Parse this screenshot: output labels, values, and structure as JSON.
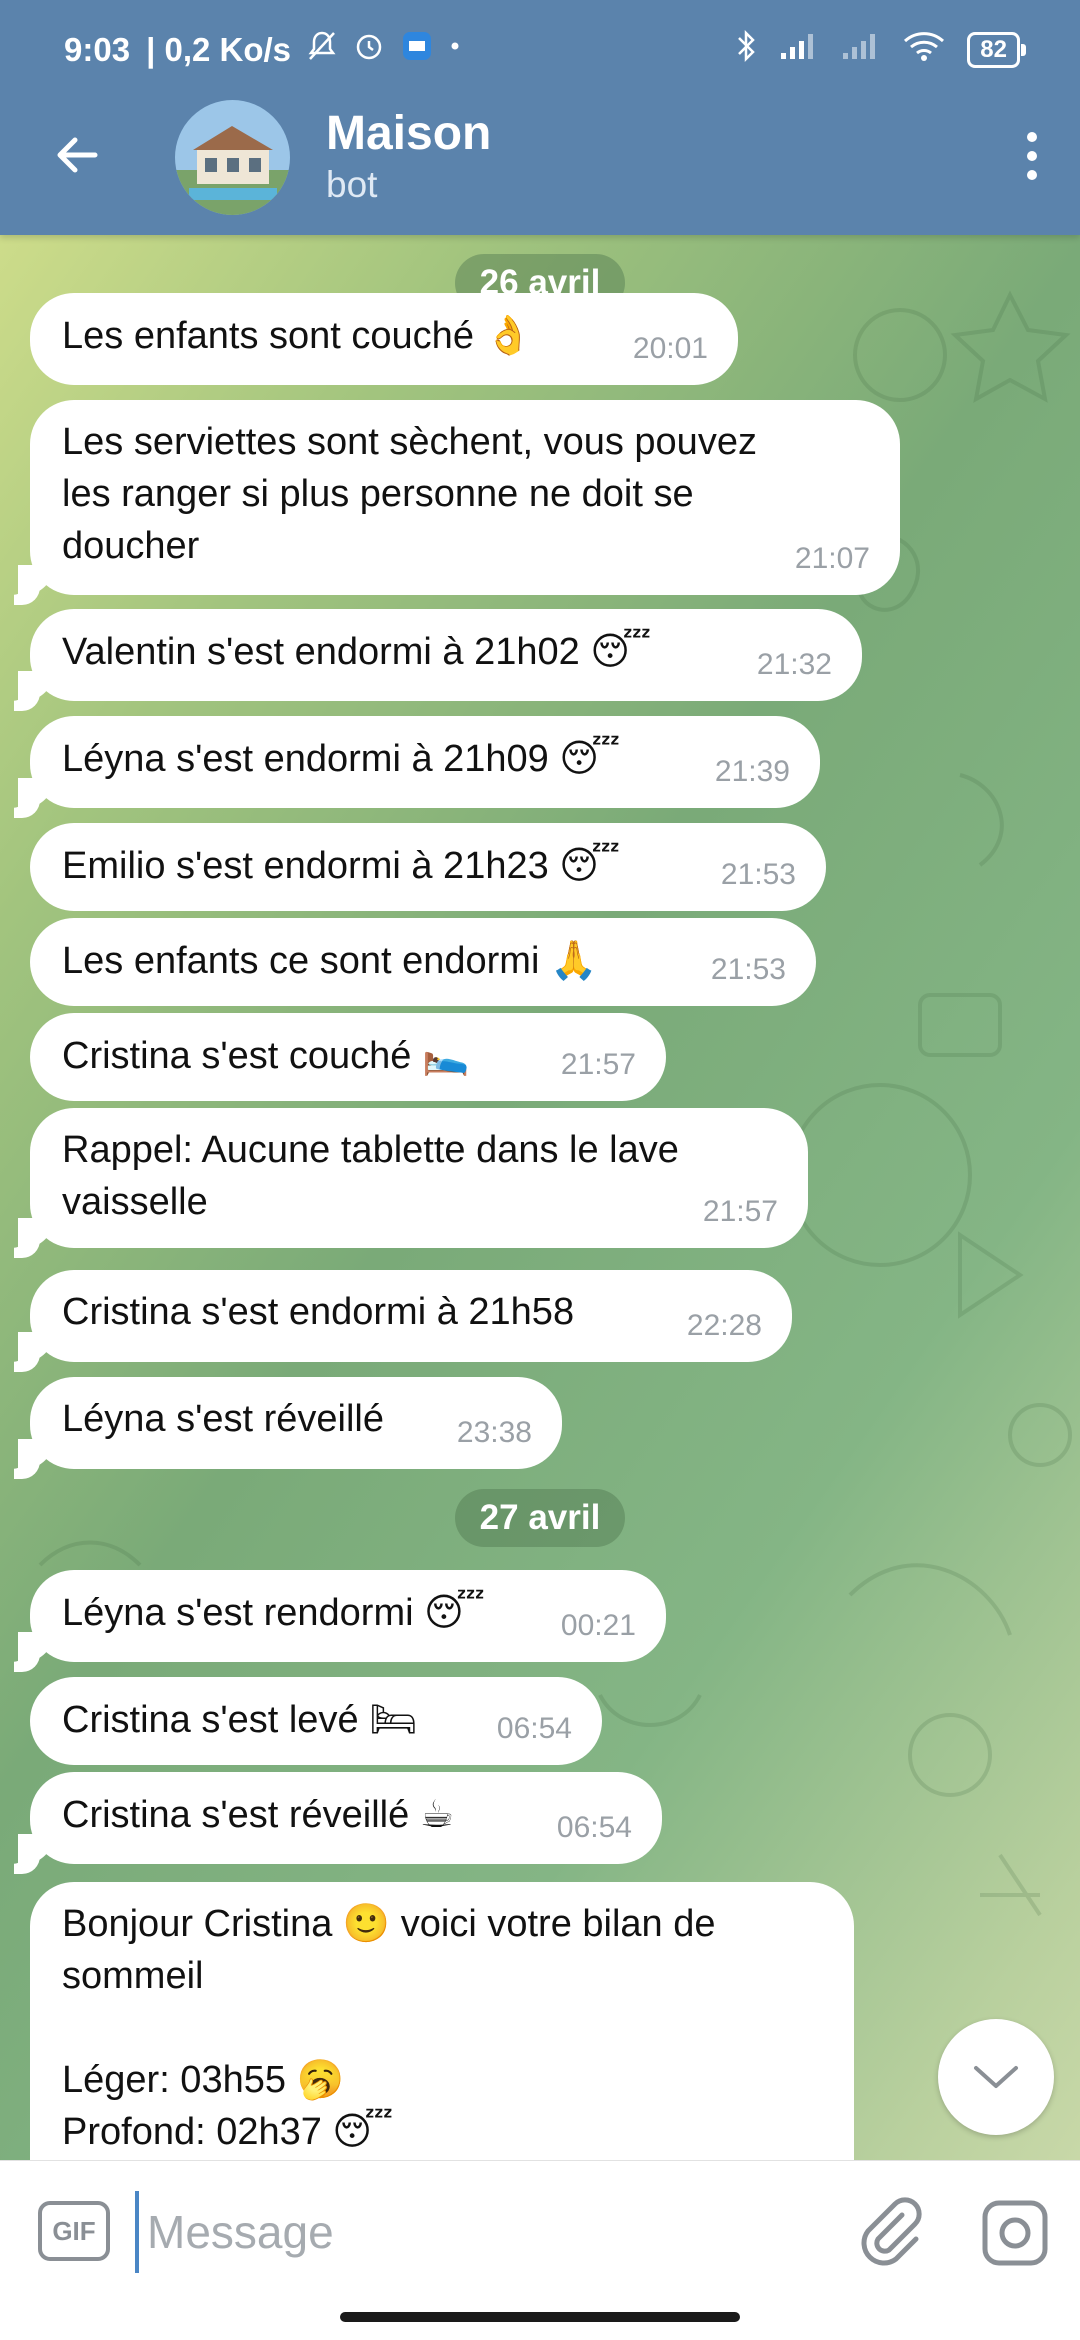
{
  "status_bar": {
    "time": "9:03",
    "net_speed": "| 0,2 Ko/s",
    "battery": "82",
    "icons": [
      "bell-off-icon",
      "alarm-icon",
      "app-notification-icon",
      "bluetooth-icon",
      "signal-icon",
      "signal-icon",
      "wifi-icon"
    ]
  },
  "header": {
    "title": "Maison",
    "subtitle": "bot"
  },
  "dates": {
    "first": "26 avril",
    "second": "27 avril"
  },
  "messages": [
    {
      "text": "Les enfants sont couché",
      "emoji": "👌",
      "time": "20:01"
    },
    {
      "text": "Les serviettes sont sèchent, vous pouvez\nles ranger si plus personne ne doit se\ndoucher",
      "emoji": "",
      "time": "21:07"
    },
    {
      "text": "Valentin s'est endormi à 21h02",
      "emoji": "😴",
      "time": "21:32"
    },
    {
      "text": "Léyna s'est endormi à 21h09",
      "emoji": "😴",
      "time": "21:39"
    },
    {
      "text": "Emilio s'est endormi à 21h23",
      "emoji": "😴",
      "time": "21:53"
    },
    {
      "text": "Les enfants ce sont endormi",
      "emoji": "🙏",
      "time": "21:53"
    },
    {
      "text": "Cristina s'est couché",
      "emoji": "🛌",
      "time": "21:57"
    },
    {
      "text": "Rappel: Aucune tablette dans le lave\nvaisselle",
      "emoji": "",
      "time": "21:57"
    },
    {
      "text": "Cristina s'est endormi à 21h58",
      "emoji": "",
      "time": "22:28"
    },
    {
      "text": "Léyna s'est réveillé",
      "emoji": "",
      "time": "23:38"
    },
    {
      "text": "Léyna s'est rendormi",
      "emoji": "😴",
      "time": "00:21"
    },
    {
      "text": "Cristina s'est levé",
      "emoji": "🛏",
      "time": "06:54"
    },
    {
      "text": "Cristina s'est réveillé",
      "emoji": "☕",
      "time": "06:54"
    },
    {
      "text": "Bonjour Cristina 🙂 voici votre bilan de\nsommeil\n\nLéger: 03h55 🥱\nProfond: 02h37 😴",
      "emoji": "",
      "time": ""
    }
  ],
  "composer": {
    "gif_label": "GIF",
    "placeholder": "Message"
  },
  "colors": {
    "header_bg": "#5b83ac",
    "bubble": "#ffffff",
    "time_text": "#9aa0a6",
    "cursor": "#4a86c5"
  }
}
